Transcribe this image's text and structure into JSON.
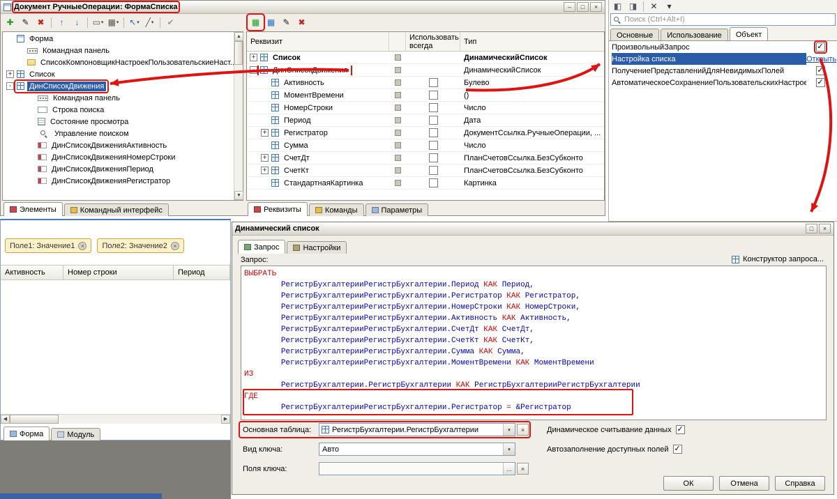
{
  "annotation_color": "#e01313",
  "glyphs": {
    "minimize": "–",
    "maximize": "□",
    "close": "×",
    "up": "▲",
    "down": "▼",
    "left": "◀",
    "right": "▶",
    "drop": "▾",
    "ellipsis": "...",
    "clear": "×",
    "check": "✓"
  },
  "main_window": {
    "title": "Документ РучныеОперации: ФормаСписка",
    "toolbar": [
      {
        "name": "add",
        "glyph": "✚",
        "color": "#1f9e1f"
      },
      {
        "name": "edit",
        "glyph": "✎",
        "color": "#1a1a1a"
      },
      {
        "name": "delete",
        "glyph": "✖",
        "color": "#c22222"
      },
      {
        "name": "sep"
      },
      {
        "name": "move-up",
        "glyph": "↑",
        "color": "#2d6fc4"
      },
      {
        "name": "move-down",
        "glyph": "↓",
        "color": "#2d6fc4"
      },
      {
        "name": "sep"
      },
      {
        "name": "dialog-mode",
        "glyph": "▭",
        "color": "#555555",
        "drop": true
      },
      {
        "name": "view-mode",
        "glyph": "▦",
        "color": "#555555",
        "drop": true
      },
      {
        "name": "sep"
      },
      {
        "name": "arrange",
        "glyph": "↖",
        "color": "#2d6fc4",
        "drop": true
      },
      {
        "name": "line-style",
        "glyph": "╱",
        "color": "#555555",
        "drop": true
      },
      {
        "name": "sep"
      },
      {
        "name": "check",
        "glyph": "✔",
        "color": "#9a9a9a"
      }
    ],
    "tree": {
      "items": [
        {
          "label": "Форма",
          "level": 0,
          "icon": "form"
        },
        {
          "label": "Командная панель",
          "level": 1,
          "icon": "cmdbar"
        },
        {
          "label": "СписокКомпоновщикНастроекПользовательскиеНаст...",
          "level": 1,
          "icon": "folder"
        },
        {
          "label": "Список",
          "level": 0,
          "icon": "grid",
          "expand": "+"
        },
        {
          "label": "ДинСписокДвижения",
          "level": 0,
          "icon": "grid",
          "expand": "-",
          "selected": true,
          "boxed": true
        },
        {
          "label": "Командная панель",
          "level": 2,
          "icon": "cmdbar"
        },
        {
          "label": "Строка поиска",
          "level": 2,
          "icon": "textfield"
        },
        {
          "label": "Состояние просмотра",
          "level": 2,
          "icon": "viewstate"
        },
        {
          "label": "Управление поиском",
          "level": 2,
          "icon": "search"
        },
        {
          "label": "ДинСписокДвиженияАктивность",
          "level": 2,
          "icon": "field"
        },
        {
          "label": "ДинСписокДвиженияНомерСтроки",
          "level": 2,
          "icon": "field"
        },
        {
          "label": "ДинСписокДвиженияПериод",
          "level": 2,
          "icon": "field"
        },
        {
          "label": "ДинСписокДвиженияРегистратор",
          "level": 2,
          "icon": "field"
        }
      ],
      "tabs": [
        {
          "label": "Элементы",
          "active": true,
          "icon_color": "#c84a4a"
        },
        {
          "label": "Командный интерфейс",
          "active": false,
          "icon_color": "#e3bd4e"
        }
      ]
    },
    "attributes": {
      "columns": [
        "Реквизит",
        "Использовать всегда",
        "Тип"
      ],
      "toolbar": [
        {
          "name": "add-attribute",
          "glyph": "▦",
          "color": "#1f9e1f",
          "boxed": true
        },
        {
          "name": "add-column",
          "glyph": "▦",
          "color": "#2d6fc4"
        },
        {
          "name": "edit-attribute",
          "glyph": "✎",
          "color": "#1a1a1a"
        },
        {
          "name": "delete-attribute",
          "glyph": "✖",
          "color": "#c22222"
        }
      ],
      "rows": [
        {
          "name": "Список",
          "type": "ДинамическийСписок",
          "level": 0,
          "expand": "+",
          "bold": true
        },
        {
          "name": "ДинСписокДвижения",
          "type": "ДинамическийСписок",
          "level": 0,
          "expand": "-",
          "boxed": true
        },
        {
          "name": "Активность",
          "type": "Булево",
          "level": 1,
          "checkbox": true
        },
        {
          "name": "МоментВремени",
          "type": "()",
          "level": 1,
          "checkbox": true
        },
        {
          "name": "НомерСтроки",
          "type": "Число",
          "level": 1,
          "checkbox": true
        },
        {
          "name": "Период",
          "type": "Дата",
          "level": 1,
          "checkbox": true
        },
        {
          "name": "Регистратор",
          "type": "ДокументСсылка.РучныеОперации, ...",
          "level": 1,
          "expand": "+",
          "checkbox": true
        },
        {
          "name": "Сумма",
          "type": "Число",
          "level": 1,
          "checkbox": true
        },
        {
          "name": "СчетДт",
          "type": "ПланСчетовСсылка.БезСубконто",
          "level": 1,
          "expand": "+",
          "checkbox": true
        },
        {
          "name": "СчетКт",
          "type": "ПланСчетовСсылка.БезСубконто",
          "level": 1,
          "expand": "+",
          "checkbox": true
        },
        {
          "name": "СтандартнаяКартинка",
          "type": "Картинка",
          "level": 1,
          "checkbox": true
        }
      ],
      "tabs": [
        {
          "label": "Реквизиты",
          "active": true,
          "icon_color": "#c84a4a"
        },
        {
          "label": "Команды",
          "active": false,
          "icon_color": "#e3bd4e"
        },
        {
          "label": "Параметры",
          "active": false,
          "icon_color": "#9db8dd"
        }
      ]
    }
  },
  "properties_panel": {
    "toolbar": [
      {
        "name": "dock-left",
        "glyph": "◧",
        "color": "#556"
      },
      {
        "name": "dock-right",
        "glyph": "◨",
        "color": "#556"
      },
      {
        "name": "sep"
      },
      {
        "name": "close-panel",
        "glyph": "✕",
        "color": "#333"
      },
      {
        "name": "chevron",
        "glyph": "▾",
        "color": "#333"
      }
    ],
    "search": {
      "placeholder": "Поиск (Ctrl+Alt+I)"
    },
    "tabs": [
      {
        "label": "Основные",
        "active": false
      },
      {
        "label": "Использование",
        "active": false
      },
      {
        "label": "Объект",
        "active": true
      }
    ],
    "rows": [
      {
        "label": "ПроизвольныйЗапрос",
        "checked": true,
        "boxed": true
      },
      {
        "label": "Настройка списка",
        "selected": true,
        "link": "Открыть"
      },
      {
        "label": "ПолучениеПредставленийДляНевидимыхПолей",
        "checked": true
      },
      {
        "label": "АвтоматическоеСохранениеПользовательскихНастроек",
        "checked": true
      }
    ]
  },
  "form_preview": {
    "chips": [
      {
        "label": "Поле1: Значение1"
      },
      {
        "label": "Поле2: Значение2"
      }
    ],
    "columns": [
      "Активность",
      "Номер строки",
      "Период"
    ],
    "tabs": [
      {
        "label": "Форма",
        "active": true,
        "icon_color": "#9db8dd"
      },
      {
        "label": "Модуль",
        "active": false,
        "icon_color": "#c8d4e8"
      }
    ]
  },
  "dialog": {
    "title": "Динамический список",
    "tabs": [
      {
        "label": "Запрос",
        "active": true,
        "icon_color": "#7aa37a"
      },
      {
        "label": "Настройки",
        "active": false,
        "icon_color": "#b0a070"
      }
    ],
    "query_label": "Запрос:",
    "query_builder_link": "Конструктор запроса...",
    "query": {
      "keywords": [
        "ВЫБРАТЬ",
        "КАК",
        "ИЗ",
        "ГДЕ",
        "="
      ],
      "lines": [
        "ВЫБРАТЬ",
        "\tРегистрБухгалтерииРегистрБухгалтерии.Период КАК Период,",
        "\tРегистрБухгалтерииРегистрБухгалтерии.Регистратор КАК Регистратор,",
        "\tРегистрБухгалтерииРегистрБухгалтерии.НомерСтроки КАК НомерСтроки,",
        "\tРегистрБухгалтерииРегистрБухгалтерии.Активность КАК Активность,",
        "\tРегистрБухгалтерииРегистрБухгалтерии.СчетДт КАК СчетДт,",
        "\tРегистрБухгалтерииРегистрБухгалтерии.СчетКт КАК СчетКт,",
        "\tРегистрБухгалтерииРегистрБухгалтерии.Сумма КАК Сумма,",
        "\tРегистрБухгалтерииРегистрБухгалтерии.МоментВремени КАК МоментВремени",
        "ИЗ",
        "\tРегистрБухгалтерии.РегистрБухгалтерии КАК РегистрБухгалтерииРегистрБухгалтерии",
        "ГДЕ",
        "\tРегистрБухгалтерииРегистрБухгалтерии.Регистратор = &Регистратор"
      ]
    },
    "fields": [
      {
        "label": "Основная таблица:",
        "value": "РегистрБухгалтерии.РегистрБухгалтерии",
        "boxed": true
      },
      {
        "label": "Вид ключа:",
        "value": "Авто"
      },
      {
        "label": "Поля ключа:",
        "value": ""
      }
    ],
    "checkboxes": [
      {
        "label": "Динамическое считывание данных",
        "checked": true
      },
      {
        "label": "Автозаполнение доступных полей",
        "checked": true
      }
    ],
    "buttons": [
      "ОК",
      "Отмена",
      "Справка"
    ]
  }
}
